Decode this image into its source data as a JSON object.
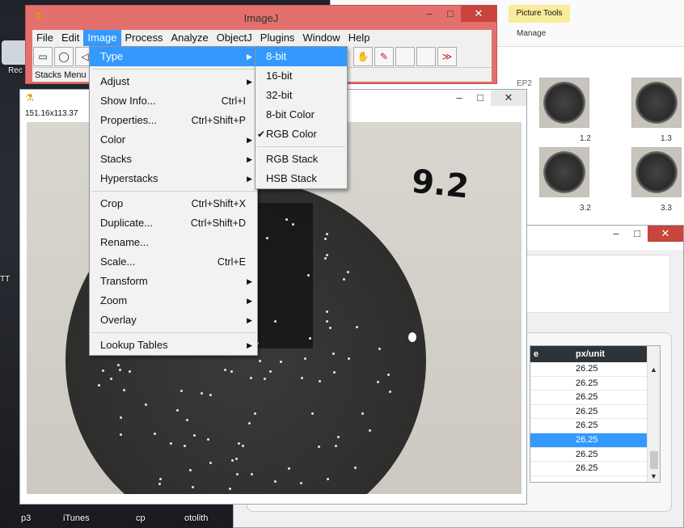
{
  "desktop": {
    "icons": [
      {
        "label": "Rec"
      },
      {
        "label": "TT"
      }
    ],
    "taskbar": [
      "p3",
      "iTunes",
      "cp",
      "otolith"
    ]
  },
  "explorer": {
    "picture_tools": "Picture Tools",
    "manage": "Manage",
    "thumb_labels": [
      "1.2",
      "1.3",
      "3.2",
      "3.3"
    ],
    "thumb_corner": "EP2"
  },
  "results": {
    "columns": [
      "e",
      "px/unit"
    ],
    "rows": [
      "26.25",
      "26.25",
      "26.25",
      "26.25",
      "26.25",
      "26.25",
      "26.25",
      "26.25"
    ],
    "selected_row": 5
  },
  "imagej": {
    "title": "ImageJ",
    "menubar": [
      "File",
      "Edit",
      "Image",
      "Process",
      "Analyze",
      "ObjectJ",
      "Plugins",
      "Window",
      "Help"
    ],
    "active_menu": "Image",
    "status": "Stacks Menu",
    "more_tools": "≫"
  },
  "image_window": {
    "info": "151.16x113.37",
    "handwriting": "9.2"
  },
  "image_menu": [
    {
      "label": "Type",
      "shortcut": "",
      "submenu": true,
      "highlight": true
    },
    {
      "sep": true
    },
    {
      "label": "Adjust",
      "shortcut": "",
      "submenu": true
    },
    {
      "label": "Show Info...",
      "shortcut": "Ctrl+I",
      "submenu": false
    },
    {
      "label": "Properties...",
      "shortcut": "Ctrl+Shift+P",
      "submenu": false
    },
    {
      "label": "Color",
      "shortcut": "",
      "submenu": true
    },
    {
      "label": "Stacks",
      "shortcut": "",
      "submenu": true
    },
    {
      "label": "Hyperstacks",
      "shortcut": "",
      "submenu": true
    },
    {
      "sep": true
    },
    {
      "label": "Crop",
      "shortcut": "Ctrl+Shift+X",
      "submenu": false
    },
    {
      "label": "Duplicate...",
      "shortcut": "Ctrl+Shift+D",
      "submenu": false
    },
    {
      "label": "Rename...",
      "shortcut": "",
      "submenu": false
    },
    {
      "label": "Scale...",
      "shortcut": "Ctrl+E",
      "submenu": false
    },
    {
      "label": "Transform",
      "shortcut": "",
      "submenu": true
    },
    {
      "label": "Zoom",
      "shortcut": "",
      "submenu": true
    },
    {
      "label": "Overlay",
      "shortcut": "",
      "submenu": true
    },
    {
      "sep": true
    },
    {
      "label": "Lookup Tables",
      "shortcut": "",
      "submenu": true
    }
  ],
  "type_menu": [
    {
      "label": "8-bit",
      "highlight": true,
      "checked": false
    },
    {
      "label": "16-bit",
      "checked": false
    },
    {
      "label": "32-bit",
      "checked": false
    },
    {
      "label": "8-bit Color",
      "checked": false
    },
    {
      "label": "RGB Color",
      "checked": true
    },
    {
      "sep": true
    },
    {
      "label": "RGB Stack",
      "checked": false
    },
    {
      "label": "HSB Stack",
      "checked": false
    }
  ],
  "colors": {
    "imagej_frame": "#e3706c",
    "highlight": "#3399ff",
    "close_button": "#c7453c"
  }
}
